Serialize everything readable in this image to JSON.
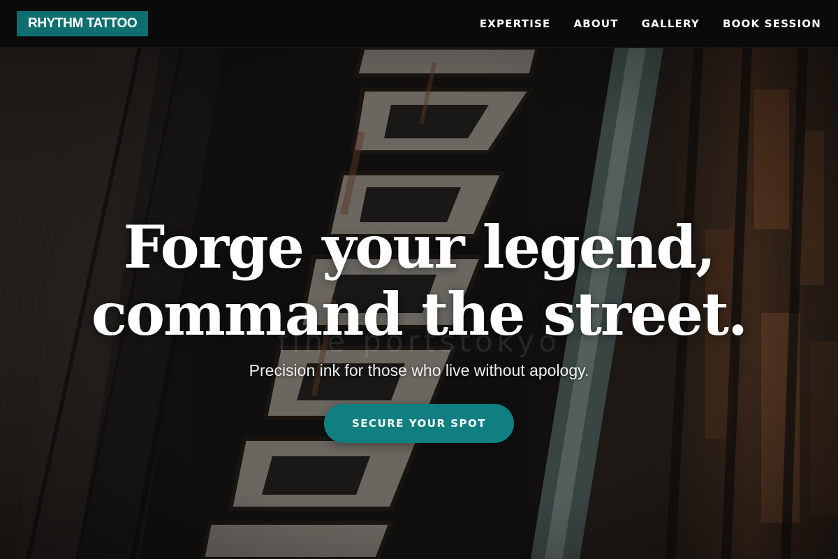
{
  "header": {
    "logo": "RHYTHM TATTOO",
    "nav": [
      {
        "label": "EXPERTISE"
      },
      {
        "label": "ABOUT"
      },
      {
        "label": "GALLERY"
      },
      {
        "label": "BOOK SESSION"
      }
    ]
  },
  "hero": {
    "headline_line1": "Forge your legend,",
    "headline_line2": "command the street.",
    "subtitle": "Precision ink for those who live without apology.",
    "cta_label": "SECURE YOUR SPOT",
    "watermark": "fine portstokyo",
    "background_image": "weathered-tattoo-shop-sign"
  },
  "colors": {
    "accent": "#0f7f82",
    "logo_bg": "#0f6f70",
    "header_bg": "#0a0a0a",
    "text": "#ffffff"
  }
}
